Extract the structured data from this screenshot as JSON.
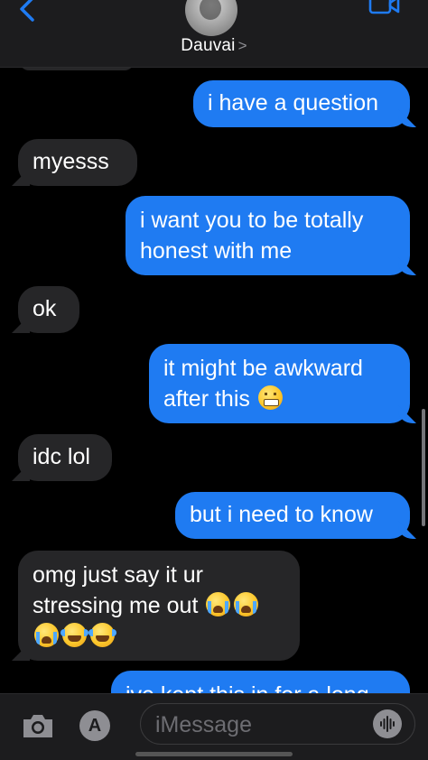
{
  "header": {
    "contact_name": "Dauvai",
    "chevron": ">"
  },
  "messages": [
    {
      "direction": "sent",
      "text": "i have a question"
    },
    {
      "direction": "received",
      "text": "myesss"
    },
    {
      "direction": "sent",
      "lines": [
        "i want you to be totally",
        "honest with me"
      ]
    },
    {
      "direction": "received",
      "text": "ok"
    },
    {
      "direction": "sent",
      "lines": [
        "it might be awkward",
        "after this"
      ],
      "emoji": [
        "grimacing-face"
      ]
    },
    {
      "direction": "received",
      "text": "idc lol"
    },
    {
      "direction": "sent",
      "text": "but i need to know"
    },
    {
      "direction": "received",
      "lines": [
        "omg just say it ur",
        "stressing me out"
      ],
      "emoji": [
        "loudly-crying-face",
        "loudly-crying-face",
        "loudly-crying-face",
        "face-with-tears-of-joy",
        "face-with-tears-of-joy"
      ]
    },
    {
      "direction": "sent",
      "text": "ive kept this in for a long"
    }
  ],
  "input_bar": {
    "placeholder": "iMessage",
    "apps_glyph": "A"
  },
  "colors": {
    "sent_bubble": "#1f7bf2",
    "received_bubble": "#262628",
    "background": "#000000"
  },
  "icons": [
    "back-chevron-icon",
    "video-camera-icon",
    "camera-icon",
    "app-store-icon",
    "audio-waveform-icon"
  ]
}
